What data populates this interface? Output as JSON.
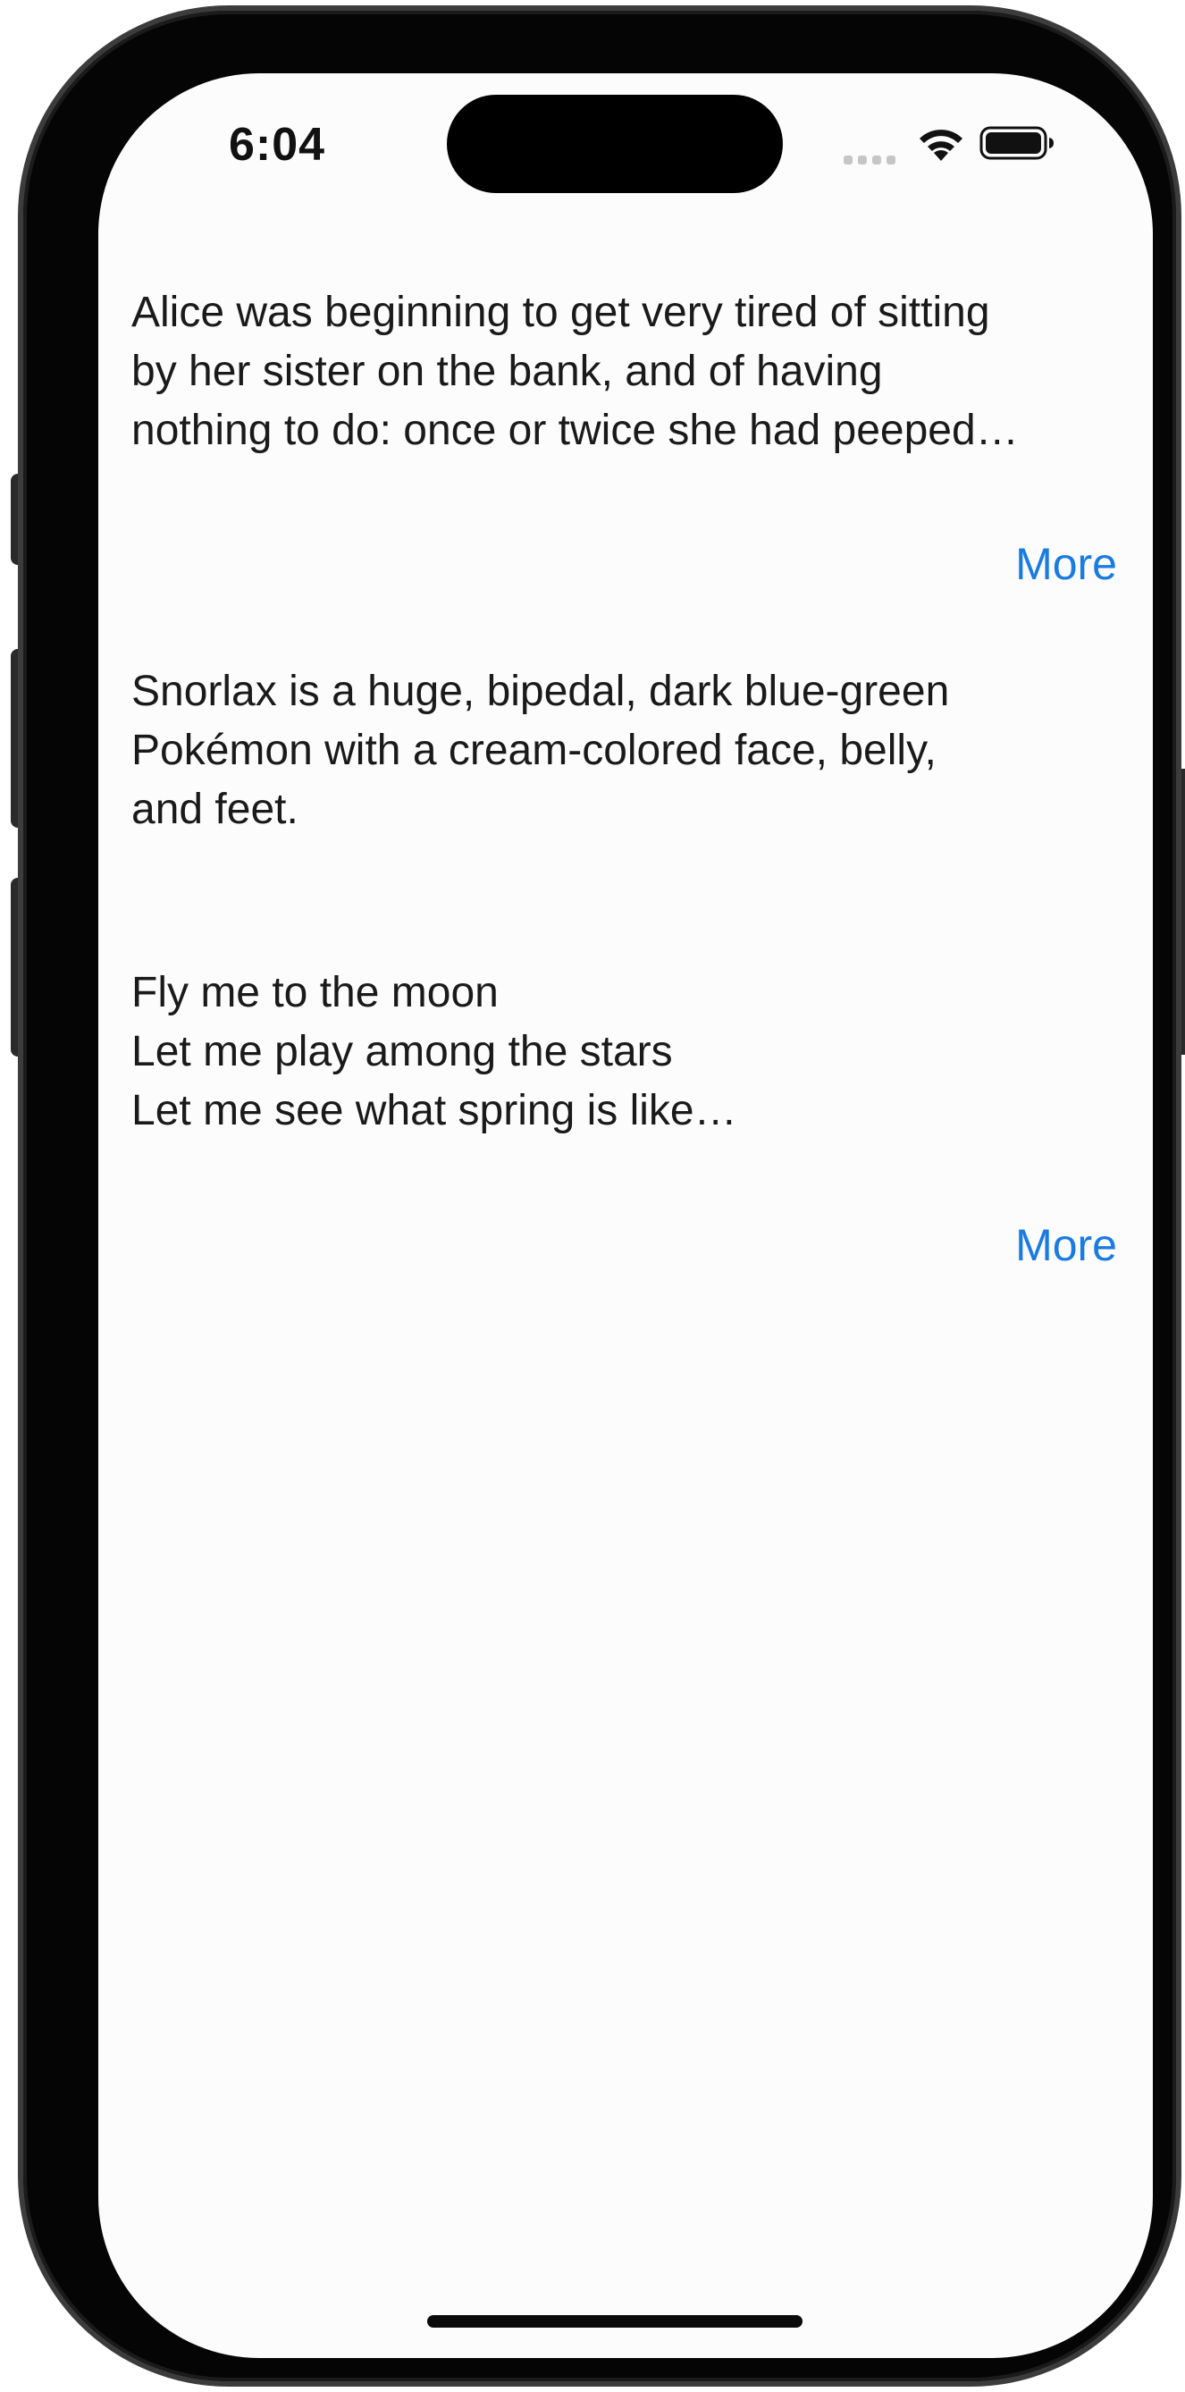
{
  "status_bar": {
    "time": "6:04",
    "icons": [
      "signal-icon",
      "wifi-icon",
      "battery-icon"
    ]
  },
  "items": [
    {
      "text": "Alice was beginning to get very tired of sitting\nby her sister on the bank, and of having\nnothing to do: once or twice she had peeped…",
      "more_label": "More"
    },
    {
      "text": "Snorlax is a huge, bipedal, dark blue-green\nPokémon with a cream-colored face, belly,\nand feet."
    },
    {
      "text": "Fly me to the moon\nLet me play among the stars\nLet me see what spring is like…",
      "more_label": "More"
    }
  ],
  "colors": {
    "link": "#1a7be2",
    "text": "#1a1a1a",
    "background": "#fcfcfc"
  }
}
